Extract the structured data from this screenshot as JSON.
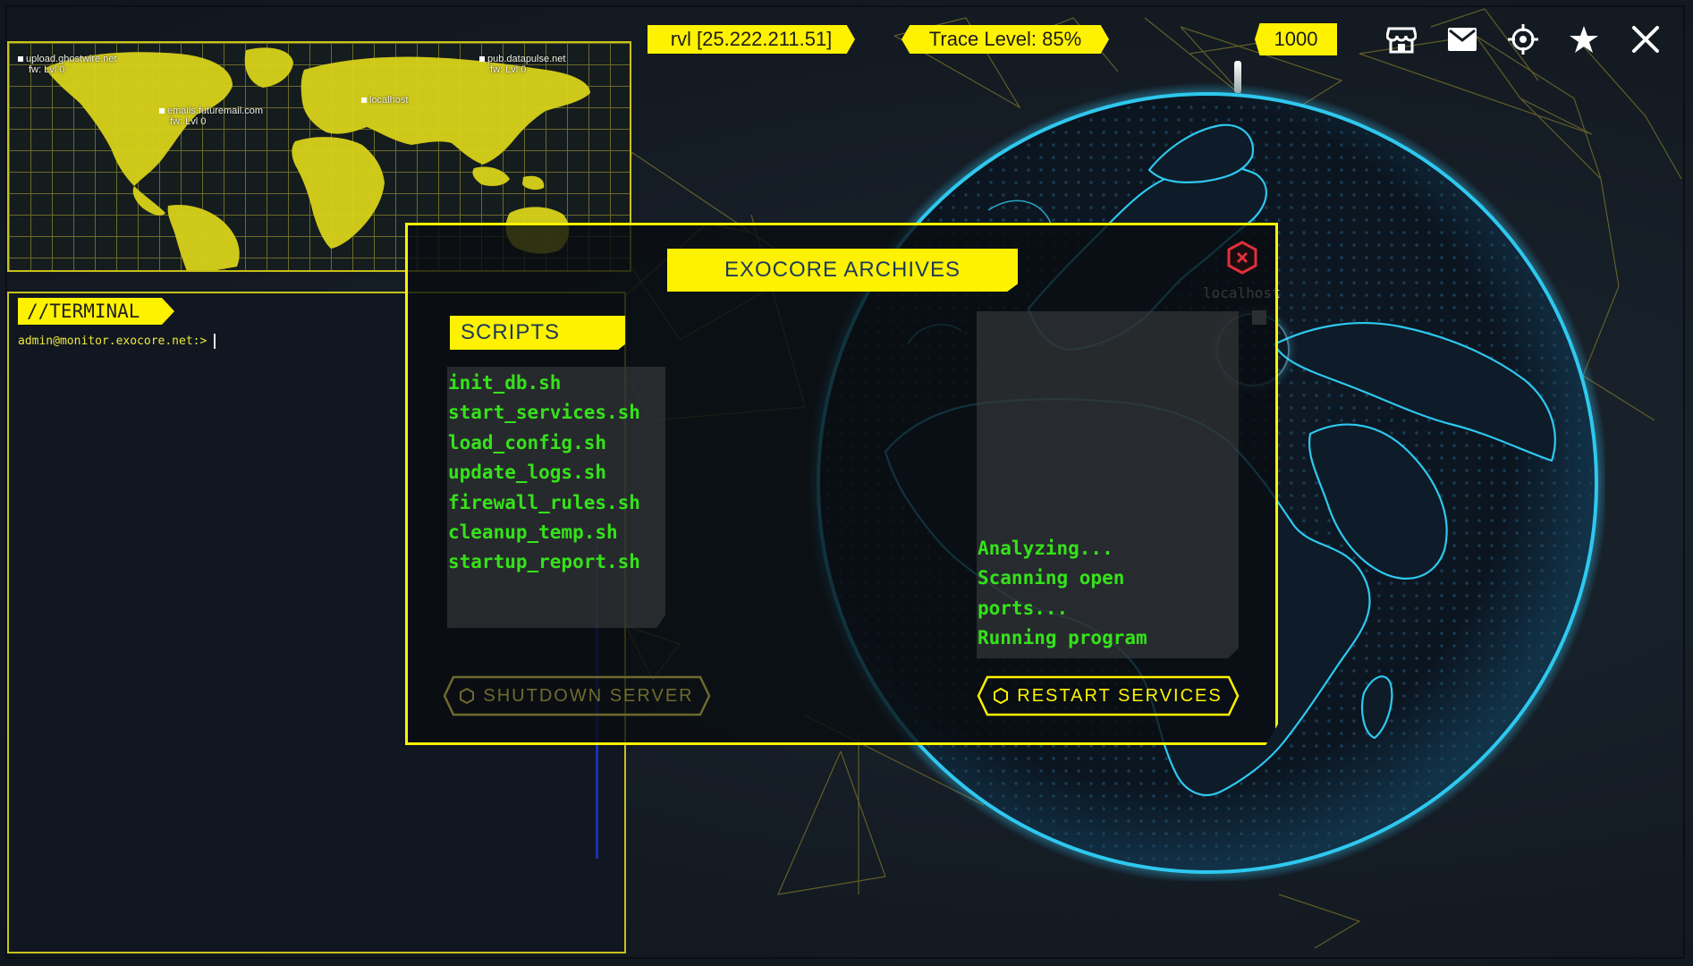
{
  "topbar": {
    "ip_label": "rvl [25.222.211.51]",
    "trace_label": "Trace Level:  85%",
    "credits": "1000",
    "icons": [
      "store-icon",
      "mail-icon",
      "target-icon",
      "star-icon",
      "close-icon"
    ]
  },
  "world_map": {
    "hosts": [
      {
        "name": "upload.ghostwire.net",
        "fw": "fw: Lvl 0"
      },
      {
        "name": "emails.futuremail.com",
        "fw": "fw: Lvl 0"
      },
      {
        "name": "localhost",
        "fw": ""
      },
      {
        "name": "pub.datapulse.net",
        "fw": "fw: Lvl 0"
      }
    ]
  },
  "terminal": {
    "title": "//TERMINAL",
    "prompt": "admin@monitor.exocore.net:>"
  },
  "dialog": {
    "title": "EXOCORE ARCHIVES",
    "scripts_title": "SCRIPTS",
    "scripts": [
      "init_db.sh",
      "start_services.sh",
      "load_config.sh",
      "update_logs.sh",
      "firewall_rules.sh",
      "cleanup_temp.sh",
      "startup_report.sh"
    ],
    "output": [
      "Analyzing...",
      "Scanning open",
      "ports...",
      "Running program"
    ],
    "shutdown_label": "SHUTDOWN SERVER",
    "restart_label": "RESTART SERVICES"
  },
  "globe": {
    "marker_label": "localhost"
  },
  "colors": {
    "accent": "#fff200",
    "terminal_green": "#35e21a",
    "globe_cyan": "#2ec8ef",
    "background": "#141b23"
  }
}
